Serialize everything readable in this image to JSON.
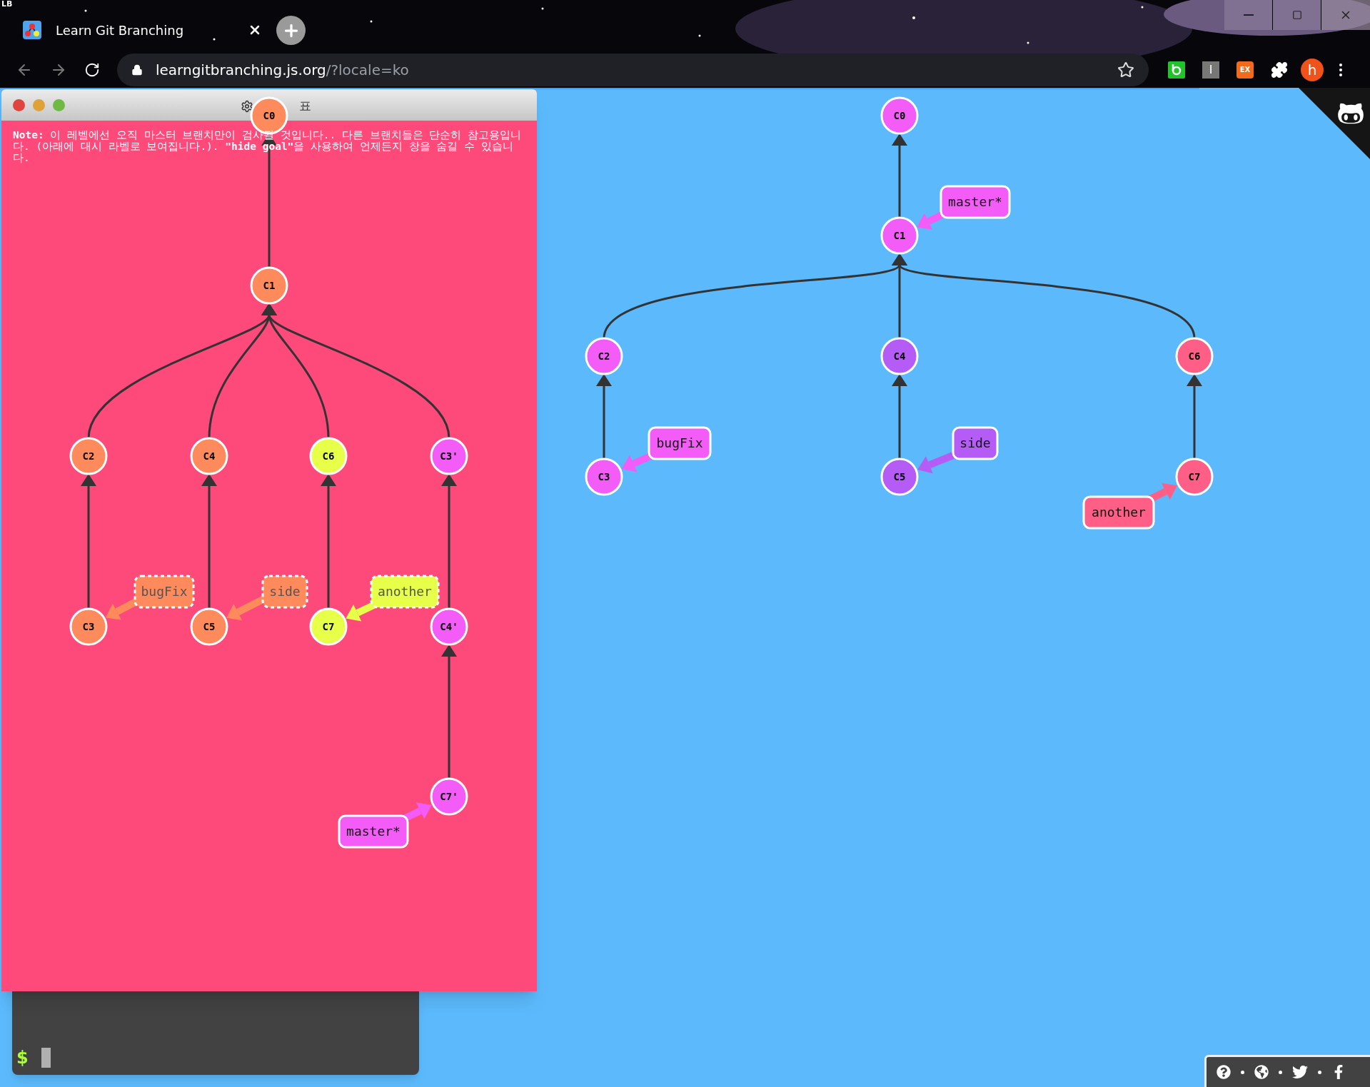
{
  "browser": {
    "corner_logo": "LB",
    "tab_title": "Learn Git Branching",
    "url_host": "learngitbranching.js.org",
    "url_path": "/?locale=ko",
    "extensions": [
      "I",
      "EX"
    ],
    "profile_initial": "h"
  },
  "goal_window": {
    "title": "표",
    "note_label": "Note:",
    "note": "이 레벨에선 오직 마스터 브랜치만이 검사될 것입니다.. 다른 브랜치들은 단순히 참고용입니다. (아래에 대시 라벨로 보여집니다.). **\"hide goal\"**을 사용하여 언제든지 창을 숨길 수 있습니다."
  },
  "goal_graph": {
    "commits": [
      {
        "id": "C0",
        "color": "#ff8a5c"
      },
      {
        "id": "C1",
        "color": "#ff8a5c"
      },
      {
        "id": "C2",
        "color": "#ff8a5c"
      },
      {
        "id": "C4",
        "color": "#ff8a5c"
      },
      {
        "id": "C6",
        "color": "#e8ff4a"
      },
      {
        "id": "C3'",
        "color": "#f35cf6"
      },
      {
        "id": "C3",
        "color": "#ff8a5c"
      },
      {
        "id": "C5",
        "color": "#ff8a5c"
      },
      {
        "id": "C7",
        "color": "#e8ff4a"
      },
      {
        "id": "C4'",
        "color": "#f35cf6"
      },
      {
        "id": "C7'",
        "color": "#f35cf6"
      }
    ],
    "branches": [
      {
        "name": "bugFix",
        "color": "#ff8a5c",
        "dashed": true
      },
      {
        "name": "side",
        "color": "#ff8a5c",
        "dashed": true
      },
      {
        "name": "another",
        "color": "#e8ff4a",
        "dashed": true
      },
      {
        "name": "master*",
        "color": "#f35cf6",
        "dashed": false
      }
    ]
  },
  "main_graph": {
    "commits": [
      {
        "id": "C0",
        "color": "#f35cf6"
      },
      {
        "id": "C1",
        "color": "#f35cf6"
      },
      {
        "id": "C2",
        "color": "#f35cf6"
      },
      {
        "id": "C4",
        "color": "#b45cf5"
      },
      {
        "id": "C6",
        "color": "#ff5f86"
      },
      {
        "id": "C3",
        "color": "#f35cf6"
      },
      {
        "id": "C5",
        "color": "#b45cf5"
      },
      {
        "id": "C7",
        "color": "#ff5f86"
      }
    ],
    "branches": [
      {
        "name": "master*",
        "color": "#f35cf6",
        "dashed": false
      },
      {
        "name": "bugFix",
        "color": "#f35cf6",
        "dashed": false
      },
      {
        "name": "side",
        "color": "#b45cf5",
        "dashed": false
      },
      {
        "name": "another",
        "color": "#ff5f86",
        "dashed": false
      }
    ]
  },
  "terminal": {
    "prompt": "$"
  }
}
